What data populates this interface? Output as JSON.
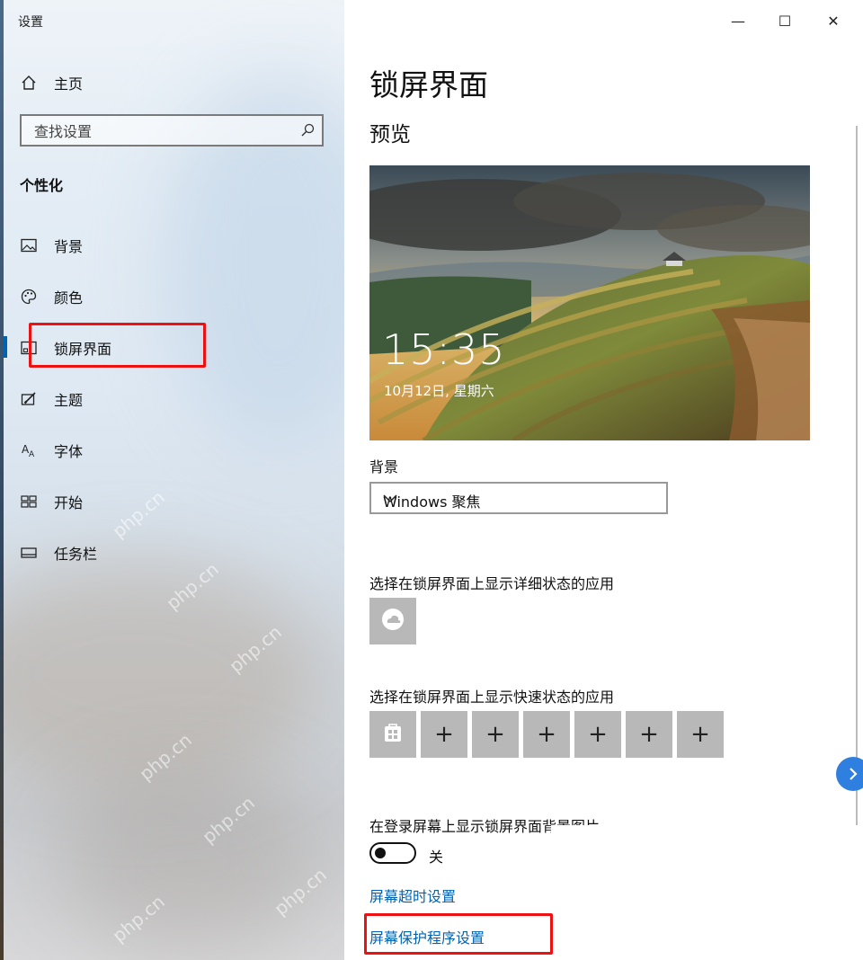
{
  "window": {
    "title": "设置",
    "minimize": "—",
    "maximize": "☐",
    "close": "✕"
  },
  "sidebar": {
    "home_label": "主页",
    "search_placeholder": "查找设置",
    "section_title": "个性化",
    "items": [
      {
        "label": "背景",
        "icon": "picture-icon"
      },
      {
        "label": "颜色",
        "icon": "palette-icon"
      },
      {
        "label": "锁屏界面",
        "icon": "lock-screen-icon",
        "active": true
      },
      {
        "label": "主题",
        "icon": "theme-icon"
      },
      {
        "label": "字体",
        "icon": "font-icon"
      },
      {
        "label": "开始",
        "icon": "start-icon"
      },
      {
        "label": "任务栏",
        "icon": "taskbar-icon"
      }
    ]
  },
  "main": {
    "title": "锁屏界面",
    "preview_heading": "预览",
    "preview": {
      "time": "15:35",
      "date": "10月12日, 星期六"
    },
    "background_label": "背景",
    "background_value": "Windows 聚焦",
    "detailed_status_label": "选择在锁屏界面上显示详细状态的应用",
    "quick_status_label": "选择在锁屏界面上显示快速状态的应用",
    "quick_tiles": [
      "+",
      "+",
      "+",
      "+",
      "+",
      "+"
    ],
    "signin_bg_label": "在登录屏幕上显示锁屏界面背景图片",
    "signin_bg_state": "关",
    "signin_bg_on": false,
    "timeout_link": "屏幕超时设置",
    "screensaver_link": "屏幕保护程序设置"
  },
  "watermark": "php.cn",
  "colors": {
    "accent": "#0063b1",
    "highlight": "#e11111",
    "tile": "#b8b8b8"
  }
}
